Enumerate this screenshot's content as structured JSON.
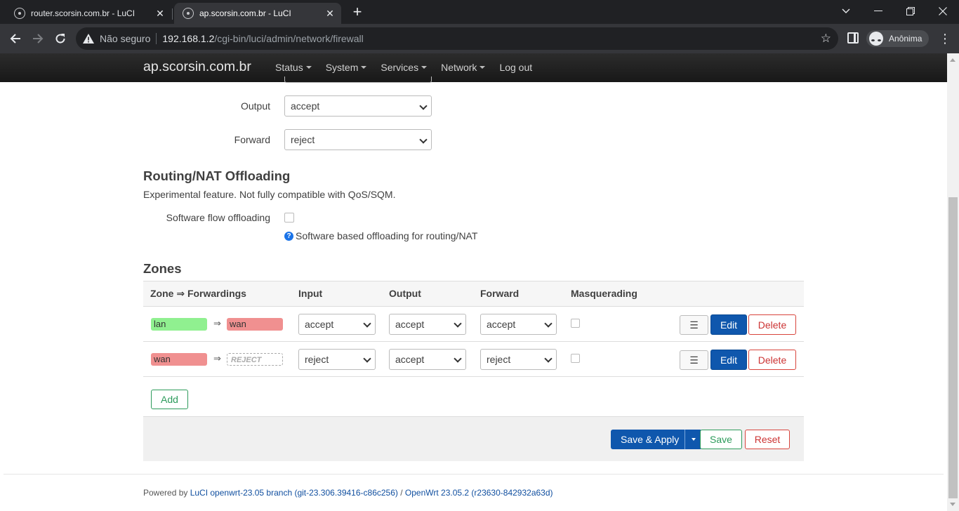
{
  "browser": {
    "tabs": [
      {
        "title": "router.scorsin.com.br - LuCI",
        "active": false
      },
      {
        "title": "ap.scorsin.com.br - LuCI",
        "active": true
      }
    ],
    "address": {
      "security_label": "Não seguro",
      "host": "192.168.1.2",
      "path": "/cgi-bin/luci/admin/network/firewall"
    },
    "profile_label": "Anônima"
  },
  "luci": {
    "brand": "ap.scorsin.com.br",
    "menu": [
      "Status",
      "System",
      "Services",
      "Network",
      "Log out"
    ]
  },
  "defaults": {
    "output_label": "Output",
    "output_value": "accept",
    "forward_label": "Forward",
    "forward_value": "reject"
  },
  "offloading": {
    "title": "Routing/NAT Offloading",
    "description": "Experimental feature. Not fully compatible with QoS/SQM.",
    "sw_label": "Software flow offloading",
    "sw_checked": false,
    "sw_help": "Software based offloading for routing/NAT"
  },
  "zones": {
    "title": "Zones",
    "headers": [
      "Zone ⇒ Forwardings",
      "Input",
      "Output",
      "Forward",
      "Masquerading"
    ],
    "arrow": "⇒",
    "rows": [
      {
        "zone": "lan",
        "target": "wan",
        "input": "accept",
        "output": "accept",
        "forward": "accept",
        "masq": false
      },
      {
        "zone": "wan",
        "target": "REJECT",
        "input": "reject",
        "output": "accept",
        "forward": "reject",
        "masq": false
      }
    ],
    "menu_glyph": "☰",
    "edit_label": "Edit",
    "delete_label": "Delete",
    "add_label": "Add"
  },
  "actions": {
    "save_apply": "Save & Apply",
    "save": "Save",
    "reset": "Reset"
  },
  "footer": {
    "prefix": "Powered by ",
    "luci_link": "LuCI openwrt-23.05 branch (git-23.306.39416-c86c256)",
    "sep": " / ",
    "openwrt_link": "OpenWrt 23.05.2 (r23630-842932a63d)"
  },
  "colors": {
    "zone_lan": "#90f090",
    "zone_wan": "#f09090",
    "primary": "#0f57ad",
    "positive": "#2d9b5b",
    "negative": "#d8443c"
  }
}
